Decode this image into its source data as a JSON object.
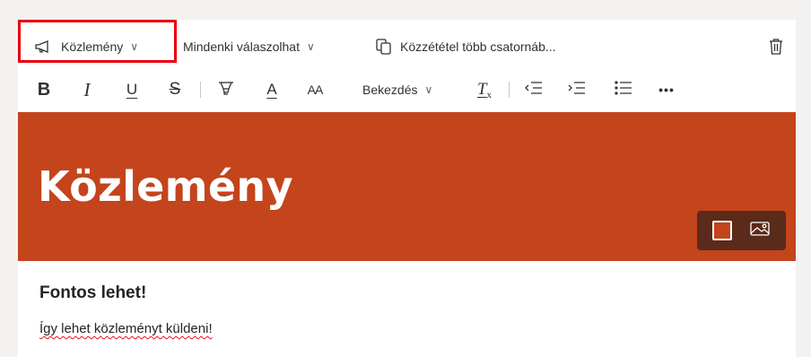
{
  "toolbar": {
    "post_type": "Közlemény",
    "reply_setting": "Mindenki válaszolhat",
    "crosspost": "Közzététel több csatornáb...",
    "paragraph": "Bekezdés"
  },
  "icons": {
    "post_type": "megaphone-icon",
    "crosspost": "copy-icon",
    "delete": "trash-icon",
    "bold": "bold-icon",
    "italic": "italic-icon",
    "underline": "underline-icon",
    "strike": "strikethrough-icon",
    "highlight": "highlighter-icon",
    "font_color": "font-color-icon",
    "font_size": "font-size-icon",
    "clear_format": "clear-formatting-icon",
    "outdent": "decrease-indent-icon",
    "indent": "increase-indent-icon",
    "bullets": "bulleted-list-icon",
    "more": "more-options-icon",
    "image": "image-icon"
  },
  "glyphs": {
    "bold": "B",
    "italic": "I",
    "underline": "U",
    "strike": "S",
    "font_color": "A",
    "font_size": "AA",
    "clear": "T",
    "more": "•••",
    "chevron": "∨"
  },
  "banner": {
    "title": "Közlemény",
    "color": "#c4441c"
  },
  "post": {
    "subject": "Fontos lehet!",
    "body": "Így lehet közleményt küldeni!"
  },
  "colors": {
    "highlight_box": "#e8000b",
    "banner": "#c4441c"
  }
}
